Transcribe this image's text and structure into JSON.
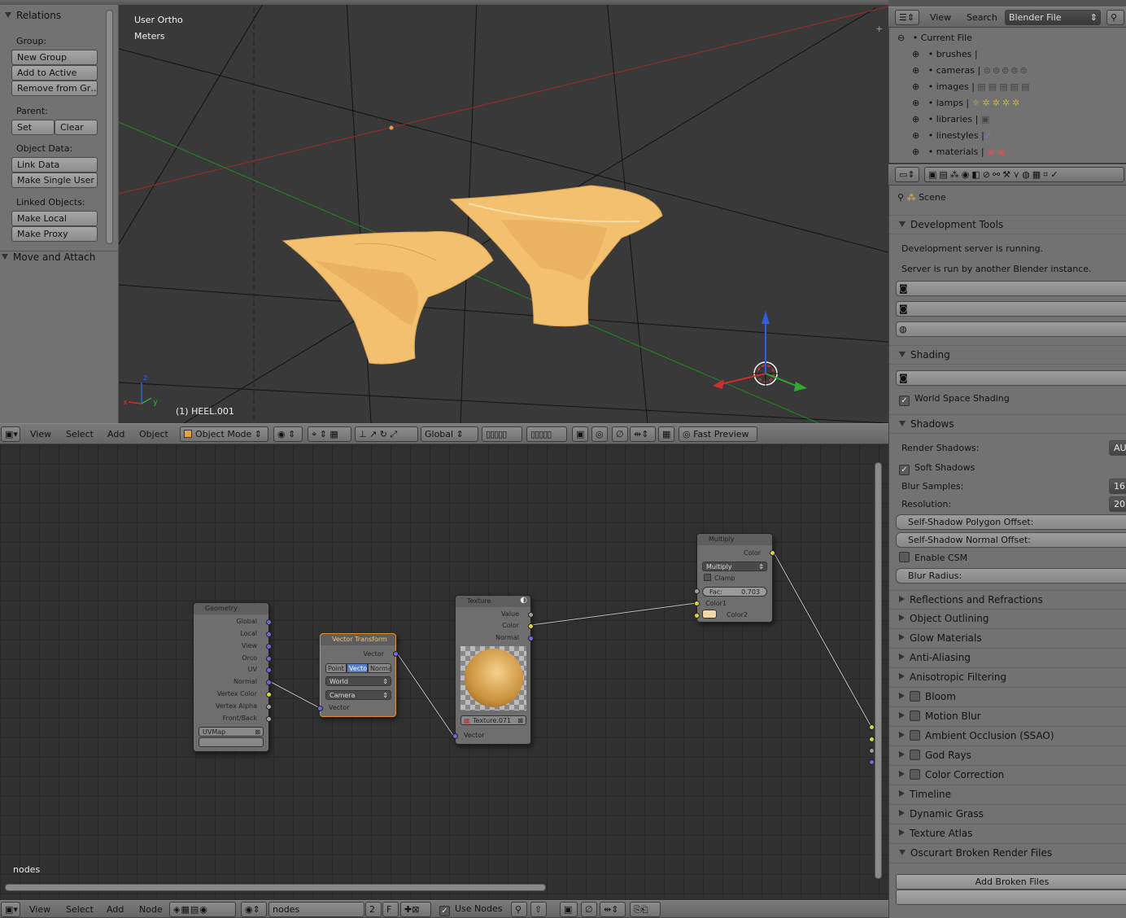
{
  "toolshelf": {
    "relations_title": "Relations",
    "group_label": "Group:",
    "new_group": "New Group",
    "add_to_active": "Add to Active",
    "remove_from_group": "Remove from Gr…",
    "parent_label": "Parent:",
    "set": "Set",
    "clear": "Clear",
    "object_data_label": "Object Data:",
    "link_data": "Link Data",
    "make_single_user": "Make Single User",
    "linked_objects_label": "Linked Objects:",
    "make_local": "Make Local",
    "make_proxy": "Make Proxy",
    "move_attach": "Move and Attach"
  },
  "viewport": {
    "view_name": "User Ortho",
    "units": "Meters",
    "object_info": "(1) HEEL.001",
    "axis_x": "x",
    "axis_y": "y",
    "axis_z": "z"
  },
  "view3d_header": {
    "view": "View",
    "select": "Select",
    "add": "Add",
    "object": "Object",
    "mode": "Object Mode",
    "orientation": "Global",
    "fast_preview": "Fast Preview"
  },
  "node_editor": {
    "tree_name_overlay": "nodes",
    "nodes": {
      "geometry": {
        "title": "Geometry",
        "outputs": [
          "Global",
          "Local",
          "View",
          "Orco",
          "UV",
          "Normal",
          "Vertex Color",
          "Vertex Alpha",
          "Front/Back"
        ],
        "uvmap": "UVMap"
      },
      "vector_transform": {
        "title": "Vector Transform",
        "output": "Vector",
        "types": [
          "Point",
          "Vector",
          "Normal"
        ],
        "active_type": "Vector",
        "convert_from": "World",
        "convert_to": "Camera",
        "input": "Vector"
      },
      "texture": {
        "title": "Texture",
        "outputs": [
          "Value",
          "Color",
          "Normal"
        ],
        "texture_name": "Texture.071",
        "input": "Vector"
      },
      "multiply": {
        "title": "Multiply",
        "output": "Color",
        "blend": "Multiply",
        "clamp": "Clamp",
        "fac_label": "Fac:",
        "fac_value": "0.703",
        "color1": "Color1",
        "color2": "Color2",
        "color2_swatch": "#f0d8a8"
      }
    }
  },
  "node_header": {
    "view": "View",
    "select": "Select",
    "add": "Add",
    "node": "Node",
    "tree_name": "nodes",
    "users": "2",
    "fake_user": "F",
    "use_nodes": "Use Nodes"
  },
  "outliner": {
    "view": "View",
    "search": "Search",
    "display_mode": "Blender File",
    "current_file": "Current File",
    "items": [
      "brushes",
      "cameras",
      "images",
      "lamps",
      "libraries",
      "linestyles",
      "materials"
    ]
  },
  "properties": {
    "context": "Scene",
    "dev_tools": "Development Tools",
    "dev_msg1": "Development server is running.",
    "dev_msg2": "Server is run by another Blender instance.",
    "shading": "Shading",
    "world_space_shading": "World Space Shading",
    "shadows": "Shadows",
    "render_shadows_label": "Render Shadows:",
    "render_shadows_value": "AU",
    "soft_shadows": "Soft Shadows",
    "blur_samples_label": "Blur Samples:",
    "blur_samples_value": "16",
    "resolution_label": "Resolution:",
    "resolution_value": "20",
    "self_shadow_polygon": "Self-Shadow Polygon Offset:",
    "self_shadow_normal": "Self-Shadow Normal Offset:",
    "enable_csm": "Enable CSM",
    "blur_radius": "Blur Radius:",
    "sections": [
      "Reflections and Refractions",
      "Object Outlining",
      "Glow Materials",
      "Anti-Aliasing",
      "Anisotropic Filtering"
    ],
    "check_sections": [
      "Bloom",
      "Motion Blur",
      "Ambient Occlusion (SSAO)",
      "God Rays",
      "Color Correction"
    ],
    "tail_sections": [
      "Timeline",
      "Dynamic Grass",
      "Texture Atlas"
    ],
    "broken_render": "Oscurart Broken Render Files",
    "add_broken": "Add Broken Files"
  },
  "colors": {
    "heel": "#f2c06e",
    "heel_shadow": "#c9923e",
    "x_axis": "#cc2f2f",
    "y_axis": "#2fa82f",
    "z_axis": "#2f5fe0"
  }
}
